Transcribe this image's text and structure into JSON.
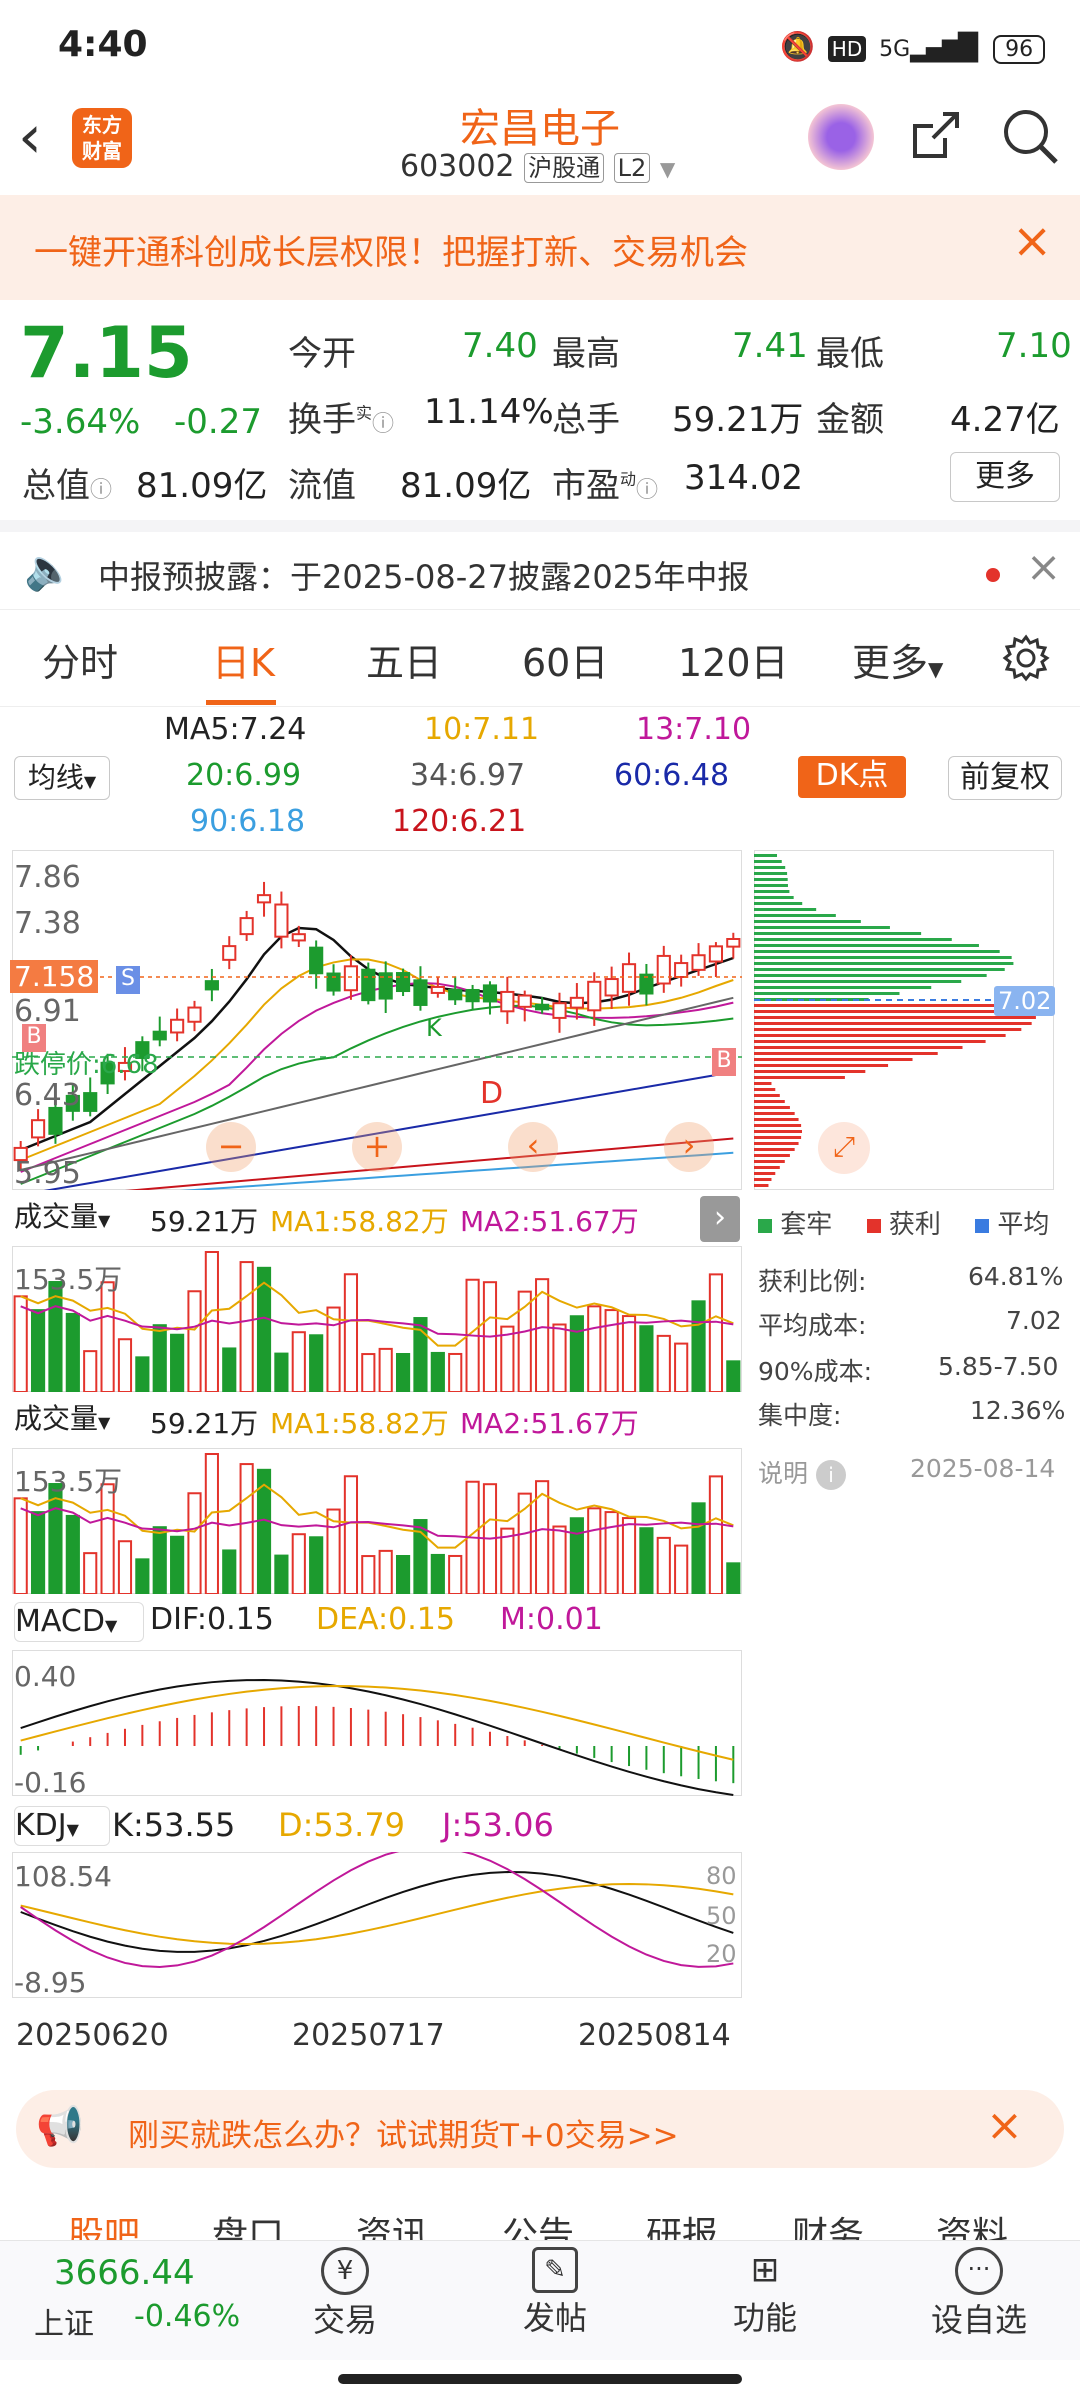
{
  "status": {
    "time": "4:40",
    "battery": "96",
    "net": "5G"
  },
  "header": {
    "name": "宏昌电子",
    "code": "603002",
    "market_tag": "沪股通",
    "level": "L2",
    "logo_text_1": "东方",
    "logo_text_2": "财富"
  },
  "banner": {
    "text": "一键开通科创成长层权限！把握打新、交易机会"
  },
  "quote": {
    "price": "7.15",
    "pct": "-3.64%",
    "chg": "-0.27",
    "open_label": "今开",
    "open": "7.40",
    "high_label": "最高",
    "high": "7.41",
    "low_label": "最低",
    "low": "7.10",
    "turnover_label": "换手",
    "turnover_sup": "实",
    "turnover": "11.14%",
    "vol_label": "总手",
    "vol": "59.21万",
    "amt_label": "金额",
    "amt": "4.27亿",
    "mktcap_label": "总值",
    "mktcap": "81.09亿",
    "float_label": "流值",
    "float": "81.09亿",
    "pe_label": "市盈",
    "pe_sup": "动",
    "pe": "314.02",
    "more": "更多"
  },
  "notice": {
    "text": "中报预披露：于2025-08-27披露2025年中报"
  },
  "tabs": [
    {
      "label": "分时"
    },
    {
      "label": "日K"
    },
    {
      "label": "五日"
    },
    {
      "label": "60日"
    },
    {
      "label": "120日"
    },
    {
      "label": "更多"
    }
  ],
  "ma": {
    "selector": "均线",
    "ma5": "MA5:7.24",
    "ma10": "10:7.11",
    "ma13": "13:7.10",
    "ma20": "20:6.99",
    "ma34": "34:6.97",
    "ma60": "60:6.48",
    "ma90": "90:6.18",
    "ma120": "120:6.21",
    "dk": "DK点",
    "adjust": "前复权"
  },
  "kline": {
    "y_labels": [
      "7.86",
      "7.38",
      "6.91",
      "6.43",
      "5.95"
    ],
    "cur_price_tag": "7.158",
    "limit_down_label": "跌停价:6.68",
    "marker_s": "S",
    "marker_b": "B",
    "marker_d": "D",
    "marker_k": "K",
    "chip_price_tag": "7.02"
  },
  "chips": {
    "legend": [
      "套牢",
      "获利",
      "平均"
    ],
    "rows": [
      {
        "label": "获利比例:",
        "value": "64.81%"
      },
      {
        "label": "平均成本:",
        "value": "7.02"
      },
      {
        "label": "90%成本:",
        "value": "5.85-7.50"
      },
      {
        "label": "集中度:",
        "value": "12.36%"
      }
    ],
    "note_label": "说明",
    "date": "2025-08-14"
  },
  "vol1": {
    "selector": "成交量",
    "val": "59.21万",
    "ma1": "MA1:58.82万",
    "ma2": "MA2:51.67万",
    "ylabel": "153.5万"
  },
  "vol2": {
    "selector": "成交量",
    "val": "59.21万",
    "ma1": "MA1:58.82万",
    "ma2": "MA2:51.67万",
    "ylabel": "153.5万"
  },
  "macd": {
    "selector": "MACD",
    "dif": "DIF:0.15",
    "dea": "DEA:0.15",
    "m": "M:0.01",
    "top": "0.40",
    "bottom": "-0.16"
  },
  "kdj": {
    "selector": "KDJ",
    "k": "K:53.55",
    "d": "D:53.79",
    "j": "J:53.06",
    "top": "108.54",
    "bottom": "-8.95",
    "r80": "80",
    "r50": "50",
    "r20": "20"
  },
  "dates": [
    "20250620",
    "20250717",
    "20250814"
  ],
  "ad": {
    "text": "刚买就跌怎么办？试试期货T+0交易>>"
  },
  "subtabs": [
    "股吧",
    "盘口",
    "资讯",
    "公告",
    "研报",
    "财务",
    "资料"
  ],
  "bottom": {
    "index_value": "3666.44",
    "index_name": "上证",
    "index_pct": "-0.46%",
    "trade": "交易",
    "post": "发帖",
    "func": "功能",
    "watch": "设自选"
  },
  "colors": {
    "up": "#e3332b",
    "down": "#1c9b2e",
    "accent": "#f06418"
  }
}
